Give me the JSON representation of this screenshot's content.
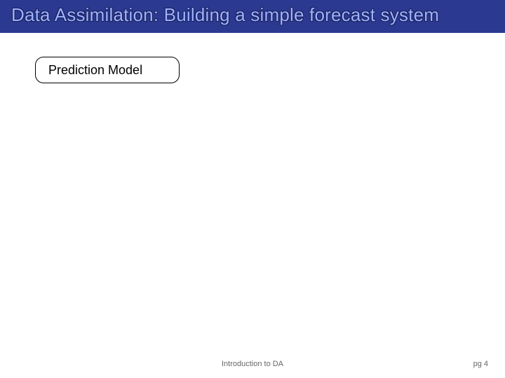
{
  "slide": {
    "title": "Data Assimilation: Building a simple forecast system",
    "box_label": "Prediction Model",
    "footer_center": "Introduction to DA",
    "footer_right": "pg 4"
  }
}
